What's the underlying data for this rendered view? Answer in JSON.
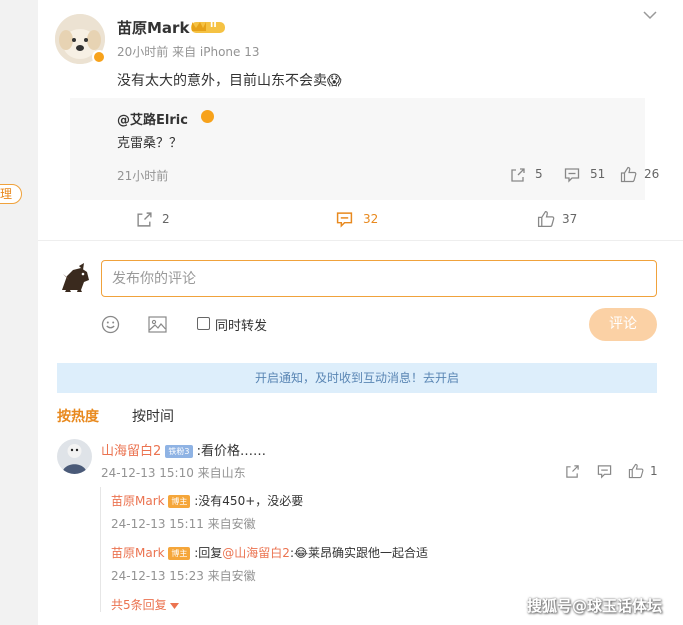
{
  "side_pill": "理",
  "post": {
    "author": "苗原Mark",
    "vip_badge": "II",
    "meta": "20小时前 来自 iPhone 13",
    "text": "没有太大的意外，目前山东不会卖",
    "emoji": "😱"
  },
  "quoted": {
    "author": "@艾路Elric",
    "text": "克雷桑？？",
    "time": "21小时前",
    "share_count": "5",
    "comment_count": "51",
    "like_count": "26"
  },
  "post_actions": {
    "share_count": "2",
    "comment_count": "32",
    "like_count": "37"
  },
  "composer": {
    "placeholder": "发布你的评论",
    "repost_label": "同时转发",
    "submit_label": "评论"
  },
  "notice": "开启通知，及时收到互动消息！去开启",
  "sort_tabs": {
    "hot": "按热度",
    "time": "按时间"
  },
  "comments": [
    {
      "author": "山海留白2",
      "badge": "铁粉3",
      "text": ":看价格……",
      "meta": "24-12-13 15:10 来自山东",
      "like_count": "1",
      "replies": [
        {
          "author": "苗原Mark",
          "badge": "博主",
          "text": ":没有450+，没必要",
          "meta": "24-12-13 15:11 来自安徽"
        },
        {
          "author": "苗原Mark",
          "badge": "博主",
          "prefix": ":回复",
          "mention": "@山海留白2",
          "colon": ":",
          "emoji": "😂",
          "text": "莱昂确实跟他一起合适",
          "meta": "24-12-13 15:23 来自安徽"
        }
      ],
      "more_replies": "共5条回复"
    }
  ],
  "watermark": "搜狐号@球玉话体坛",
  "colors": {
    "accent": "#e8891e",
    "link": "#eb7350",
    "notice_bg": "#ddeefb"
  }
}
